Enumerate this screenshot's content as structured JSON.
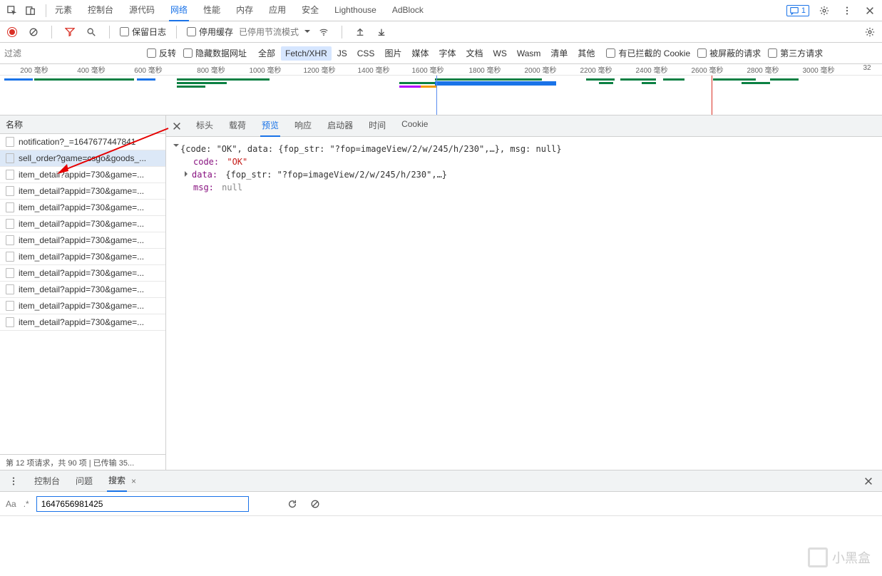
{
  "top_tabs": [
    "元素",
    "控制台",
    "源代码",
    "网络",
    "性能",
    "内存",
    "应用",
    "安全",
    "Lighthouse",
    "AdBlock"
  ],
  "active_top_tab": 3,
  "message_badge": "1",
  "toolbar": {
    "keep_log": "保留日志",
    "disable_cache": "停用缓存",
    "throttling": "已停用节流模式"
  },
  "filter": {
    "placeholder": "过滤",
    "invert": "反转",
    "hide_data_urls": "隐藏数据网址",
    "types": [
      "全部",
      "Fetch/XHR",
      "JS",
      "CSS",
      "图片",
      "媒体",
      "字体",
      "文档",
      "WS",
      "Wasm",
      "清单",
      "其他"
    ],
    "active_type": 1,
    "blocked_cookies": "有已拦截的 Cookie",
    "blocked_requests": "被屏蔽的请求",
    "third_party": "第三方请求"
  },
  "ticks": [
    "200 毫秒",
    "400 毫秒",
    "600 毫秒",
    "800 毫秒",
    "1000 毫秒",
    "1200 毫秒",
    "1400 毫秒",
    "1600 毫秒",
    "1800 毫秒",
    "2000 毫秒",
    "2200 毫秒",
    "2400 毫秒",
    "2600 毫秒",
    "2800 毫秒",
    "3000 毫秒",
    "32"
  ],
  "reqlist_header": "名称",
  "requests": [
    "notification?_=1647677447841",
    "sell_order?game=csgo&goods_...",
    "item_detail?appid=730&game=...",
    "item_detail?appid=730&game=...",
    "item_detail?appid=730&game=...",
    "item_detail?appid=730&game=...",
    "item_detail?appid=730&game=...",
    "item_detail?appid=730&game=...",
    "item_detail?appid=730&game=...",
    "item_detail?appid=730&game=...",
    "item_detail?appid=730&game=...",
    "item_detail?appid=730&game=..."
  ],
  "selected_request": 1,
  "status_text": "第 12 项请求，共 90 项  |  已传输 35...",
  "detail_tabs": [
    "标头",
    "载荷",
    "预览",
    "响应",
    "启动器",
    "时间",
    "Cookie"
  ],
  "active_detail_tab": 2,
  "preview": {
    "line1": "{code: \"OK\", data: {fop_str: \"?fop=imageView/2/w/245/h/230\",…}, msg: null}",
    "code_k": "code:",
    "code_v": "\"OK\"",
    "data_k": "data:",
    "data_v": "{fop_str: \"?fop=imageView/2/w/245/h/230\",…}",
    "msg_k": "msg:",
    "msg_v": "null"
  },
  "bottom": {
    "tabs": [
      "控制台",
      "问题",
      "搜索"
    ],
    "active": 2,
    "aa": "Aa",
    "regex": ".*",
    "value": "1647656981425",
    "watermark": "小黑盒"
  }
}
